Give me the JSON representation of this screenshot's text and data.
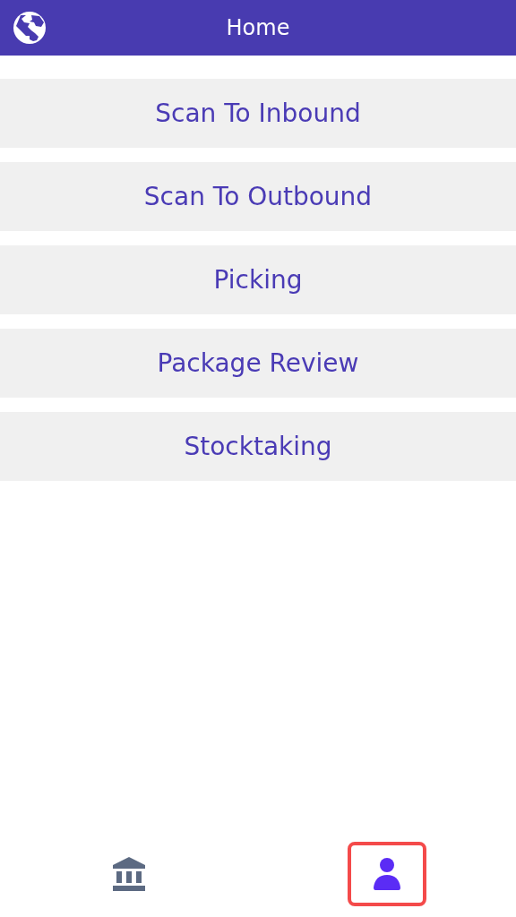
{
  "header": {
    "title": "Home"
  },
  "menu_items": [
    {
      "label": "Scan To Inbound"
    },
    {
      "label": "Scan To Outbound"
    },
    {
      "label": "Picking"
    },
    {
      "label": "Package Review"
    },
    {
      "label": "Stocktaking"
    }
  ],
  "tab_bar": [
    {
      "kind": "bank",
      "selected": false,
      "highlighted": false
    },
    {
      "kind": "profile",
      "selected": true,
      "highlighted": true
    }
  ]
}
